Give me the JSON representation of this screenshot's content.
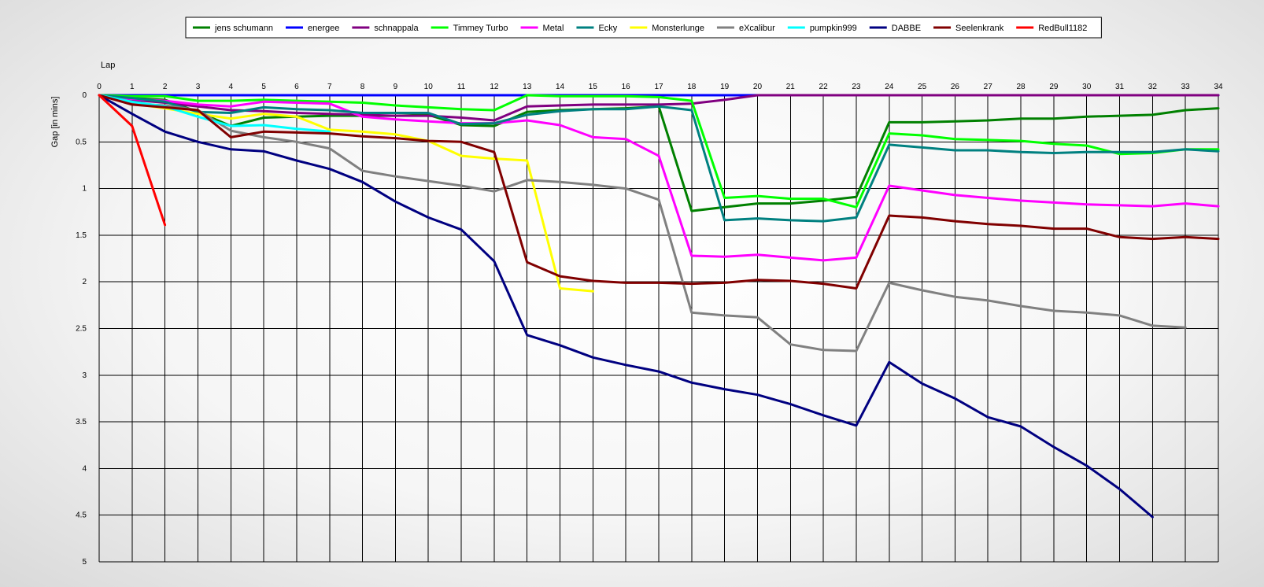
{
  "chart_data": {
    "type": "line",
    "title": "",
    "xlabel": "Lap",
    "ylabel": "Gap [in mins]",
    "xlim": [
      0,
      34
    ],
    "ylim": [
      0,
      5
    ],
    "y_inverted": true,
    "x_axis_position": "top",
    "x_ticks": [
      0,
      1,
      2,
      3,
      4,
      5,
      6,
      7,
      8,
      9,
      10,
      11,
      12,
      13,
      14,
      15,
      16,
      17,
      18,
      19,
      20,
      21,
      22,
      23,
      24,
      25,
      26,
      27,
      28,
      29,
      30,
      31,
      32,
      33,
      34
    ],
    "y_ticks": [
      0,
      0.5,
      1,
      1.5,
      2,
      2.5,
      3,
      3.5,
      4,
      4.5,
      5
    ],
    "y_tick_labels": [
      "0",
      "0.5",
      "1",
      "1.5",
      "2",
      "2.5",
      "3",
      "3.5",
      "4",
      "4.5",
      "5"
    ],
    "grid": true,
    "legend_position": "top-center",
    "series": [
      {
        "name": "jens  schumann",
        "color": "#008000",
        "x": [
          0,
          1,
          2,
          3,
          4,
          5,
          6,
          7,
          8,
          9,
          10,
          11,
          12,
          13,
          14,
          15,
          16,
          17,
          18,
          19,
          20,
          21,
          22,
          23,
          24,
          25,
          26,
          27,
          28,
          29,
          30,
          31,
          32,
          33,
          34
        ],
        "y": [
          0,
          0.03,
          0.05,
          0.18,
          0.33,
          0.24,
          0.23,
          0.22,
          0.22,
          0.22,
          0.21,
          0.32,
          0.33,
          0.18,
          0.16,
          0.15,
          0.14,
          0.12,
          1.24,
          1.2,
          1.16,
          1.16,
          1.13,
          1.09,
          0.29,
          0.29,
          0.28,
          0.27,
          0.25,
          0.25,
          0.23,
          0.22,
          0.21,
          0.16,
          0.14
        ]
      },
      {
        "name": "energee",
        "color": "#0000ff",
        "x": [
          0,
          1,
          2,
          3,
          4,
          5,
          6,
          7,
          8,
          9,
          10,
          11,
          12,
          13,
          14,
          15,
          16,
          17,
          18,
          19,
          20,
          21,
          22,
          23,
          24,
          25,
          26,
          27,
          28,
          29,
          30,
          31,
          32,
          33,
          34
        ],
        "y": [
          0,
          0,
          0,
          0,
          0,
          0,
          0,
          0,
          0,
          0,
          0,
          0,
          0,
          0,
          0,
          0,
          0,
          0,
          0,
          0,
          0,
          0,
          0,
          0,
          0,
          0,
          0,
          0,
          0,
          0,
          0,
          0,
          0,
          0,
          0
        ]
      },
      {
        "name": "schnappala",
        "color": "#800080",
        "x": [
          0,
          1,
          2,
          3,
          4,
          5,
          6,
          7,
          8,
          9,
          10,
          11,
          12,
          13,
          14,
          15,
          16,
          17,
          18,
          19,
          20,
          21,
          22,
          23,
          24,
          25,
          26,
          27,
          28,
          29,
          30,
          31,
          32,
          33,
          34
        ],
        "y": [
          0,
          0.05,
          0.08,
          0.12,
          0.16,
          0.17,
          0.19,
          0.2,
          0.21,
          0.22,
          0.22,
          0.24,
          0.27,
          0.12,
          0.11,
          0.1,
          0.1,
          0.1,
          0.09,
          0.05,
          0,
          0,
          0,
          0,
          0,
          0,
          0,
          0,
          0,
          0,
          0,
          0,
          0,
          0,
          0
        ]
      },
      {
        "name": "Timmey Turbo",
        "color": "#00ff00",
        "x": [
          0,
          1,
          2,
          3,
          4,
          5,
          6,
          7,
          8,
          9,
          10,
          11,
          12,
          13,
          14,
          15,
          16,
          17,
          18,
          19,
          20,
          21,
          22,
          23,
          24,
          25,
          26,
          27,
          28,
          29,
          30,
          31,
          32,
          33,
          34
        ],
        "y": [
          0,
          0.01,
          0.01,
          0.06,
          0.06,
          0.05,
          0.06,
          0.07,
          0.08,
          0.11,
          0.13,
          0.15,
          0.16,
          0,
          0.01,
          0.01,
          0.01,
          0.02,
          0.06,
          1.1,
          1.08,
          1.11,
          1.11,
          1.2,
          0.41,
          0.43,
          0.47,
          0.48,
          0.49,
          0.52,
          0.54,
          0.63,
          0.62,
          0.58,
          0.58
        ]
      },
      {
        "name": "Metal",
        "color": "#ff00ff",
        "x": [
          0,
          1,
          2,
          3,
          4,
          5,
          6,
          7,
          8,
          9,
          10,
          11,
          12,
          13,
          14,
          15,
          16,
          17,
          18,
          19,
          20,
          21,
          22,
          23,
          24,
          25,
          26,
          27,
          28,
          29,
          30,
          31,
          32,
          33,
          34
        ],
        "y": [
          0,
          0.04,
          0.06,
          0.1,
          0.12,
          0.07,
          0.08,
          0.09,
          0.23,
          0.26,
          0.28,
          0.3,
          0.3,
          0.27,
          0.32,
          0.45,
          0.47,
          0.65,
          1.72,
          1.73,
          1.71,
          1.74,
          1.77,
          1.74,
          0.97,
          1.02,
          1.07,
          1.1,
          1.13,
          1.15,
          1.17,
          1.18,
          1.19,
          1.16,
          1.19
        ]
      },
      {
        "name": "Ecky",
        "color": "#008080",
        "x": [
          0,
          1,
          2,
          3,
          4,
          5,
          6,
          7,
          8,
          9,
          10,
          11,
          12,
          13,
          14,
          15,
          16,
          17,
          18,
          19,
          20,
          21,
          22,
          23,
          24,
          25,
          26,
          27,
          28,
          29,
          30,
          31,
          32,
          33,
          34
        ],
        "y": [
          0,
          0.03,
          0.07,
          0.18,
          0.19,
          0.13,
          0.15,
          0.16,
          0.19,
          0.19,
          0.19,
          0.31,
          0.3,
          0.21,
          0.17,
          0.15,
          0.15,
          0.12,
          0.16,
          1.34,
          1.32,
          1.34,
          1.35,
          1.31,
          0.53,
          0.56,
          0.59,
          0.59,
          0.61,
          0.62,
          0.61,
          0.61,
          0.61,
          0.58,
          0.6
        ]
      },
      {
        "name": "Monsterlunge",
        "color": "#ffff00",
        "x": [
          0,
          1,
          2,
          3,
          4,
          5,
          6,
          7,
          8,
          9,
          10,
          11,
          12,
          13,
          14,
          15
        ],
        "y": [
          0,
          0.09,
          0.14,
          0.2,
          0.25,
          0.2,
          0.23,
          0.37,
          0.39,
          0.42,
          0.49,
          0.65,
          0.68,
          0.7,
          2.07,
          2.1
        ]
      },
      {
        "name": "eXcalibur",
        "color": "#808080",
        "x": [
          0,
          1,
          2,
          3,
          4,
          5,
          6,
          7,
          8,
          9,
          10,
          11,
          12,
          13,
          14,
          15,
          16,
          17,
          18,
          19,
          20,
          21,
          22,
          23,
          24,
          25,
          26,
          27,
          28,
          29,
          30,
          31,
          32,
          33
        ],
        "y": [
          0,
          0.09,
          0.11,
          0.16,
          0.38,
          0.45,
          0.5,
          0.57,
          0.81,
          0.87,
          0.92,
          0.97,
          1.03,
          0.91,
          0.93,
          0.96,
          1,
          1.12,
          2.33,
          2.36,
          2.38,
          2.67,
          2.73,
          2.74,
          2.01,
          2.09,
          2.16,
          2.2,
          2.26,
          2.31,
          2.33,
          2.36,
          2.47,
          2.49
        ]
      },
      {
        "name": "pumpkin999",
        "color": "#00ffff",
        "x": [
          0,
          1,
          2,
          3,
          4,
          5,
          6,
          7
        ],
        "y": [
          0,
          0.07,
          0.12,
          0.23,
          0.33,
          0.32,
          0.36,
          0.39
        ]
      },
      {
        "name": "DABBE",
        "color": "#000080",
        "x": [
          0,
          1,
          2,
          3,
          4,
          5,
          6,
          7,
          8,
          9,
          10,
          11,
          12,
          13,
          14,
          15,
          16,
          17,
          18,
          19,
          20,
          21,
          22,
          23,
          24,
          25,
          26,
          27,
          28,
          29,
          30,
          31,
          32
        ],
        "y": [
          0,
          0.2,
          0.39,
          0.5,
          0.58,
          0.6,
          0.7,
          0.79,
          0.93,
          1.14,
          1.31,
          1.44,
          1.78,
          2.57,
          2.68,
          2.81,
          2.89,
          2.96,
          3.08,
          3.15,
          3.21,
          3.31,
          3.43,
          3.54,
          2.86,
          3.09,
          3.25,
          3.45,
          3.55,
          3.77,
          3.97,
          4.22,
          4.52
        ]
      },
      {
        "name": "Seelenkrank",
        "color": "#800000",
        "x": [
          0,
          1,
          2,
          3,
          4,
          5,
          6,
          7,
          8,
          9,
          10,
          11,
          12,
          13,
          14,
          15,
          16,
          17,
          18,
          19,
          20,
          21,
          22,
          23,
          24,
          25,
          26,
          27,
          28,
          29,
          30,
          31,
          32,
          33,
          34
        ],
        "y": [
          0,
          0.1,
          0.13,
          0.16,
          0.45,
          0.39,
          0.4,
          0.41,
          0.44,
          0.46,
          0.49,
          0.5,
          0.61,
          1.79,
          1.94,
          1.99,
          2.01,
          2.01,
          2.02,
          2.01,
          1.98,
          1.99,
          2.02,
          2.07,
          1.29,
          1.31,
          1.35,
          1.38,
          1.4,
          1.43,
          1.43,
          1.52,
          1.54,
          1.52,
          1.54
        ]
      },
      {
        "name": "RedBull1182",
        "color": "#ff0000",
        "x": [
          0,
          1,
          2
        ],
        "y": [
          0,
          0.33,
          1.39
        ]
      }
    ]
  }
}
